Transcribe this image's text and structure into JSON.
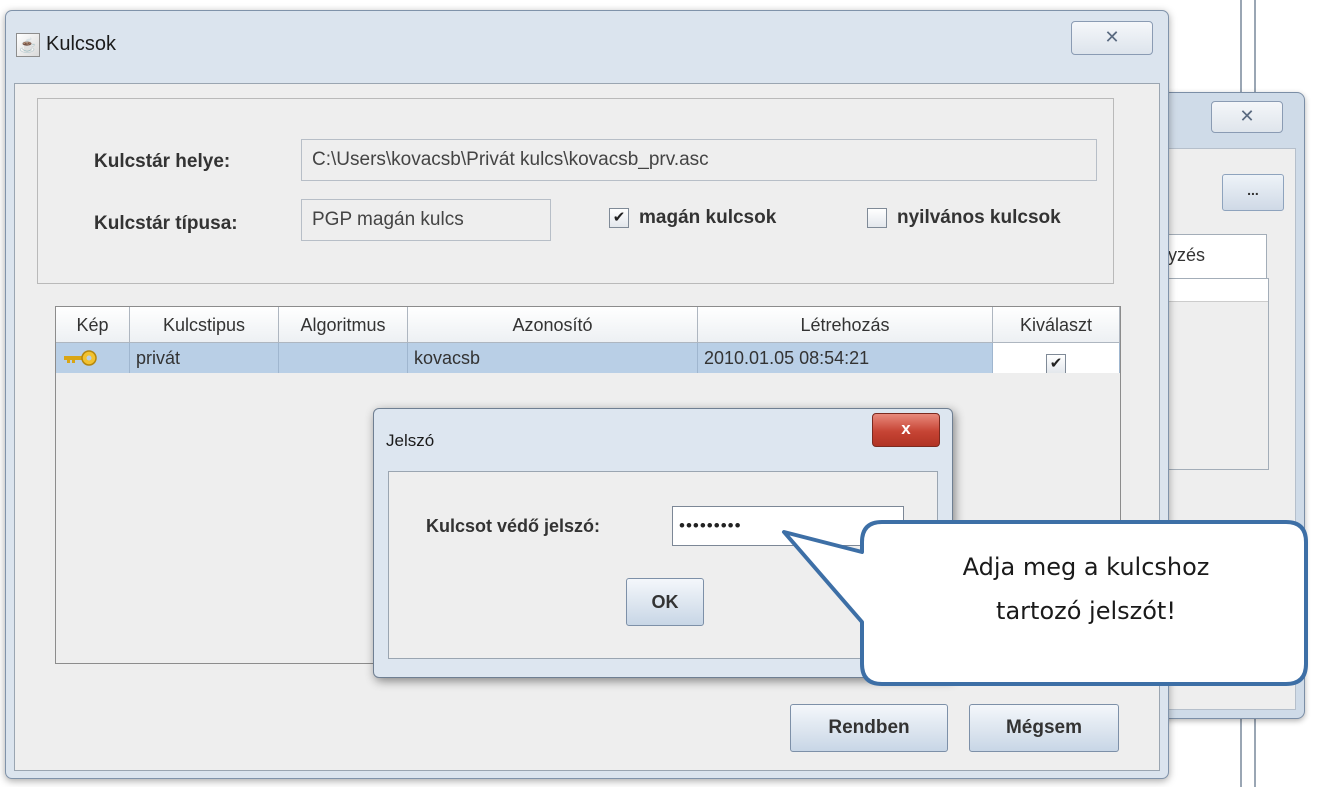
{
  "background_window": {
    "close_glyph": "✕",
    "browse_label": "...",
    "column_header": "yzés"
  },
  "window": {
    "title": "Kulcsok",
    "close_glyph": "✕"
  },
  "keystore": {
    "location_label": "Kulcstár helye:",
    "location_value": "C:\\Users\\kovacsb\\Privát kulcs\\kovacsb_prv.asc",
    "type_label": "Kulcstár típusa:",
    "type_value": "PGP magán kulcs",
    "private_keys_label": "magán kulcsok",
    "private_keys_checked": true,
    "public_keys_label": "nyilvános kulcsok",
    "public_keys_checked": false
  },
  "table": {
    "headers": [
      "Kép",
      "Kulcstipus",
      "Algoritmus",
      "Azonosító",
      "Létrehozás",
      "Kiválaszt"
    ],
    "rows": [
      {
        "icon": "key-icon",
        "type": "privát",
        "algorithm": "",
        "id": "kovacsb",
        "created": "2010.01.05 08:54:21",
        "selected_mark": "✔"
      }
    ]
  },
  "buttons": {
    "ok": "Rendben",
    "cancel": "Mégsem"
  },
  "password_dialog": {
    "title": "Jelszó",
    "close_glyph": "x",
    "label": "Kulcsot védő jelszó:",
    "value_masked": "•••••••••",
    "ok": "OK"
  },
  "callout": {
    "line1": "Adja meg a kulcshoz",
    "line2": "tartozó jelszót!"
  },
  "colors": {
    "selection": "#b9cfe6",
    "callout_border": "#3d6fa6",
    "dialog_close": "#c64434"
  }
}
